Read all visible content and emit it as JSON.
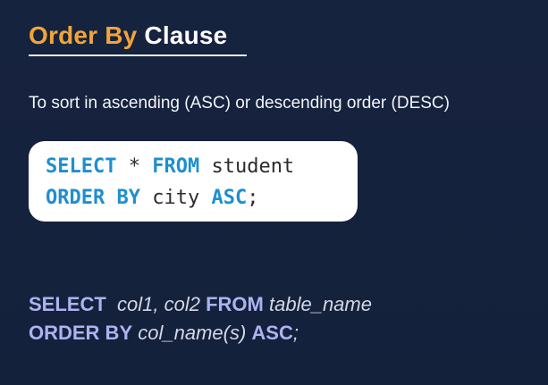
{
  "title": {
    "accent": "Order By",
    "rest": "Clause"
  },
  "description": "To sort in ascending (ASC) or descending order (DESC)",
  "example_code": {
    "line1": {
      "kw1": "SELECT",
      "star": " * ",
      "kw2": "FROM",
      "table": " student"
    },
    "line2": {
      "kw1": "ORDER BY",
      "column": " city ",
      "kw2": "ASC",
      "end": ";"
    }
  },
  "syntax": {
    "line1": {
      "kw1": "SELECT",
      "cols": "col1, col2",
      "kw2": "FROM",
      "table": "table_name"
    },
    "line2": {
      "kw1": "ORDER BY",
      "cols": "col_name(s)",
      "kw2": "ASC",
      "end": ";"
    }
  },
  "colors": {
    "background": "#15223d",
    "title_accent": "#f2a43a",
    "code_keyword": "#1e8fcf",
    "syntax_keyword": "#aeb2f0"
  }
}
